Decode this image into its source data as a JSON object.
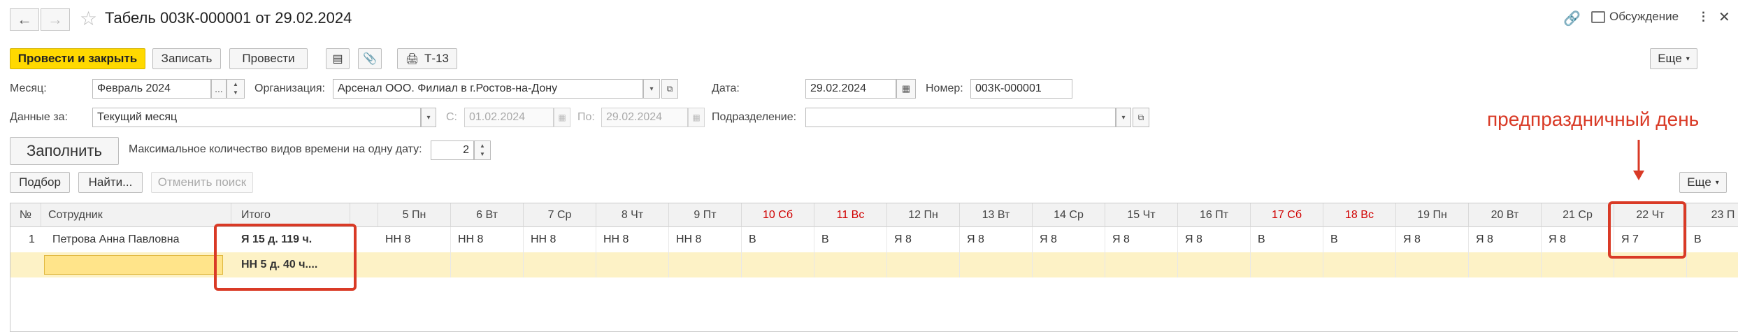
{
  "window": {
    "title": "Табель 003К-000001 от 29.02.2024",
    "discussion_label": "Обсуждение"
  },
  "toolbar": {
    "post_close": "Провести и закрыть",
    "save": "Записать",
    "post": "Провести",
    "print_t13": "Т-13",
    "more": "Еще"
  },
  "form": {
    "month_label": "Месяц:",
    "month_value": "Февраль 2024",
    "org_label": "Организация:",
    "org_value": "Арсенал ООО. Филиал в г.Ростов-на-Дону",
    "date_label": "Дата:",
    "date_value": "29.02.2024",
    "number_label": "Номер:",
    "number_value": "003К-000001",
    "data_for_label": "Данные за:",
    "data_for_value": "Текущий месяц",
    "from_label": "С:",
    "from_value": "01.02.2024",
    "to_label": "По:",
    "to_value": "29.02.2024",
    "dept_label": "Подразделение:",
    "dept_value": "",
    "fill_button": "Заполнить",
    "max_types_label": "Максимальное количество видов времени на одну дату:",
    "max_types_value": "2"
  },
  "table_toolbar": {
    "select": "Подбор",
    "find": "Найти...",
    "cancel_search": "Отменить поиск",
    "more": "Еще"
  },
  "table": {
    "col_num": "№",
    "col_employee": "Сотрудник",
    "col_total": "Итого",
    "days": [
      "5 Пн",
      "6 Вт",
      "7 Ср",
      "8 Чт",
      "9 Пт",
      "10 Сб",
      "11 Вс",
      "12 Пн",
      "13 Вт",
      "14 Ср",
      "15 Чт",
      "16 Пт",
      "17 Сб",
      "18 Вс",
      "19 Пн",
      "20 Вт",
      "21 Ср",
      "22 Чт",
      "23 П"
    ],
    "weekend_flags": [
      false,
      false,
      false,
      false,
      false,
      true,
      true,
      false,
      false,
      false,
      false,
      false,
      true,
      true,
      false,
      false,
      false,
      false,
      false
    ],
    "rows": [
      {
        "num": "1",
        "employee": "Петрова Анна Павловна",
        "total_1": "Я 15 д. 119 ч.",
        "total_2": "НН 5 д. 40 ч....",
        "days": [
          "НН 8",
          "НН 8",
          "НН 8",
          "НН 8",
          "НН 8",
          "В",
          "В",
          "Я 8",
          "Я 8",
          "Я 8",
          "Я 8",
          "Я 8",
          "В",
          "В",
          "Я 8",
          "Я 8",
          "Я 8",
          "Я 7",
          "В"
        ]
      }
    ]
  },
  "annotation": {
    "text": "предпраздничный день"
  },
  "colors": {
    "accent_yellow": "#ffd900",
    "weekend_red": "#d00000",
    "annotation_red": "#d93a26",
    "selected_row": "#fdf2c6"
  }
}
